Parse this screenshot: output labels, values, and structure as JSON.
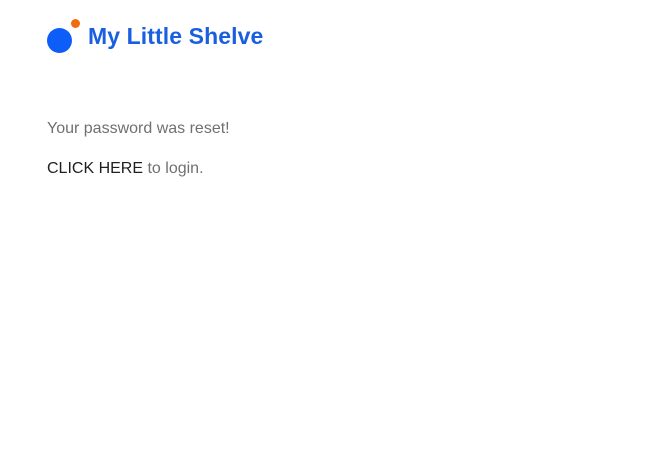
{
  "brand": {
    "name": "My Little Shelve",
    "logo_icon": "two-dot-logo-icon",
    "primary_color": "#0d5ef9",
    "accent_color": "#f26b0f",
    "name_color": "#1a5fe0"
  },
  "content": {
    "message": "Your password was reset!",
    "login_link_label": "CLICK HERE",
    "login_suffix": " to login."
  }
}
